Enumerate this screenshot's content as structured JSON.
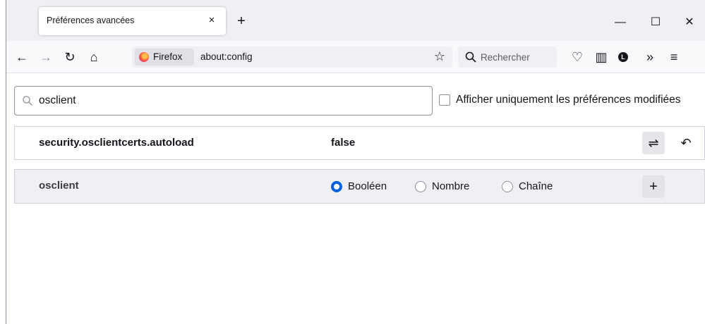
{
  "tab": {
    "title": "Préférences avancées",
    "close_label": "×",
    "new_tab_label": "+"
  },
  "window": {
    "minimize_label": "—",
    "maximize_label": "☐",
    "close_label": "✕"
  },
  "navbar": {
    "back_label": "←",
    "forward_label": "→",
    "reload_label": "↻",
    "home_label": "⌂",
    "identity_label": "Firefox",
    "url": "about:config",
    "bookmark_label": "☆",
    "search_placeholder": "Rechercher",
    "pocket_label": "♡",
    "sidebar_label": "▥",
    "account_label": "L",
    "overflow_label": "»",
    "menu_label": "≡"
  },
  "filter": {
    "value": "osclient",
    "show_modified_label": "Afficher uniquement les préférences modifiées",
    "show_modified_checked": false
  },
  "prefs": [
    {
      "name": "security.osclientcerts.autoload",
      "value": "false",
      "toggle_label": "⇌",
      "reset_label": "↶"
    }
  ],
  "new_pref": {
    "name": "osclient",
    "types": [
      {
        "label": "Booléen",
        "selected": true
      },
      {
        "label": "Nombre",
        "selected": false
      },
      {
        "label": "Chaîne",
        "selected": false
      }
    ],
    "add_label": "+"
  }
}
